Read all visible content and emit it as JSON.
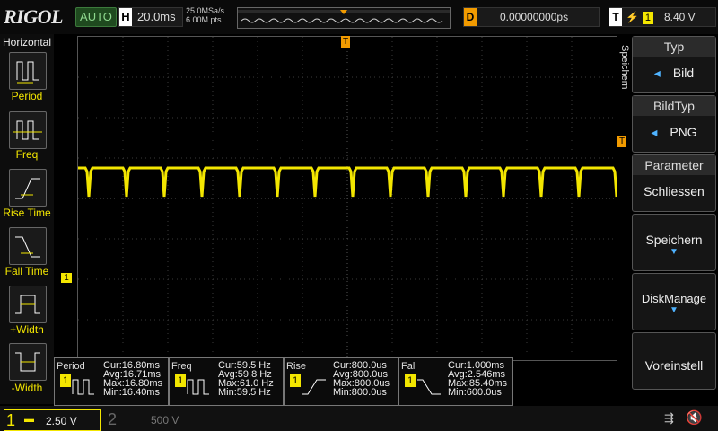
{
  "topbar": {
    "brand": "RIGOL",
    "mode": "AUTO",
    "horizontal_label": "H",
    "timebase": "20.0ms",
    "sample_rate": "25.0MSa/s",
    "memory_depth": "6.00M pts",
    "trigger_delay_label": "D",
    "trigger_delay": "0.00000000ps",
    "trigger_label": "T",
    "trigger_source": "1",
    "trigger_level": "8.40 V"
  },
  "left_menu": {
    "title": "Horizontal",
    "items": [
      {
        "label": "Period",
        "icon": "period-icon"
      },
      {
        "label": "Freq",
        "icon": "frequency-icon"
      },
      {
        "label": "Rise Time",
        "icon": "rise-time-icon"
      },
      {
        "label": "Fall Time",
        "icon": "fall-time-icon"
      },
      {
        "label": "+Width",
        "icon": "positive-width-icon"
      },
      {
        "label": "-Width",
        "icon": "negative-width-icon"
      }
    ]
  },
  "right_menu": {
    "side_label": "Speichern",
    "items": [
      {
        "header": "Typ",
        "value": "Bild"
      },
      {
        "header": "BildTyp",
        "value": "PNG"
      },
      {
        "header": "Parameter",
        "value": "Schliessen"
      },
      {
        "header": "",
        "value": "Speichern"
      },
      {
        "header": "",
        "value": "DiskManage"
      },
      {
        "header": "",
        "value": "Voreinstell"
      }
    ]
  },
  "measurements": [
    {
      "name": "Period",
      "channel": "1",
      "cur": "Cur:16.80ms",
      "avg": "Avg:16.71ms",
      "max": "Max:16.80ms",
      "min": "Min:16.40ms"
    },
    {
      "name": "Freq",
      "channel": "1",
      "cur": "Cur:59.5 Hz",
      "avg": "Avg:59.8 Hz",
      "max": "Max:61.0 Hz",
      "min": "Min:59.5 Hz"
    },
    {
      "name": "Rise",
      "channel": "1",
      "cur": "Cur:800.0us",
      "avg": "Avg:800.0us",
      "max": "Max:800.0us",
      "min": "Min:800.0us"
    },
    {
      "name": "Fall",
      "channel": "1",
      "cur": "Cur:1.000ms",
      "avg": "Avg:2.546ms",
      "max": "Max:85.40ms",
      "min": "Min:600.0us"
    }
  ],
  "channels": {
    "ch1_label": "1",
    "ch1_scale": "2.50 V",
    "ch2_label": "2",
    "ch2_scale": "500 V"
  },
  "markers": {
    "trigger_pos": "T",
    "ch1_marker": "1",
    "trigger_level_marker": "T"
  },
  "colors": {
    "ch1": "#f3e600",
    "trigger": "#f29b00",
    "auto": "#3c7a3c"
  }
}
